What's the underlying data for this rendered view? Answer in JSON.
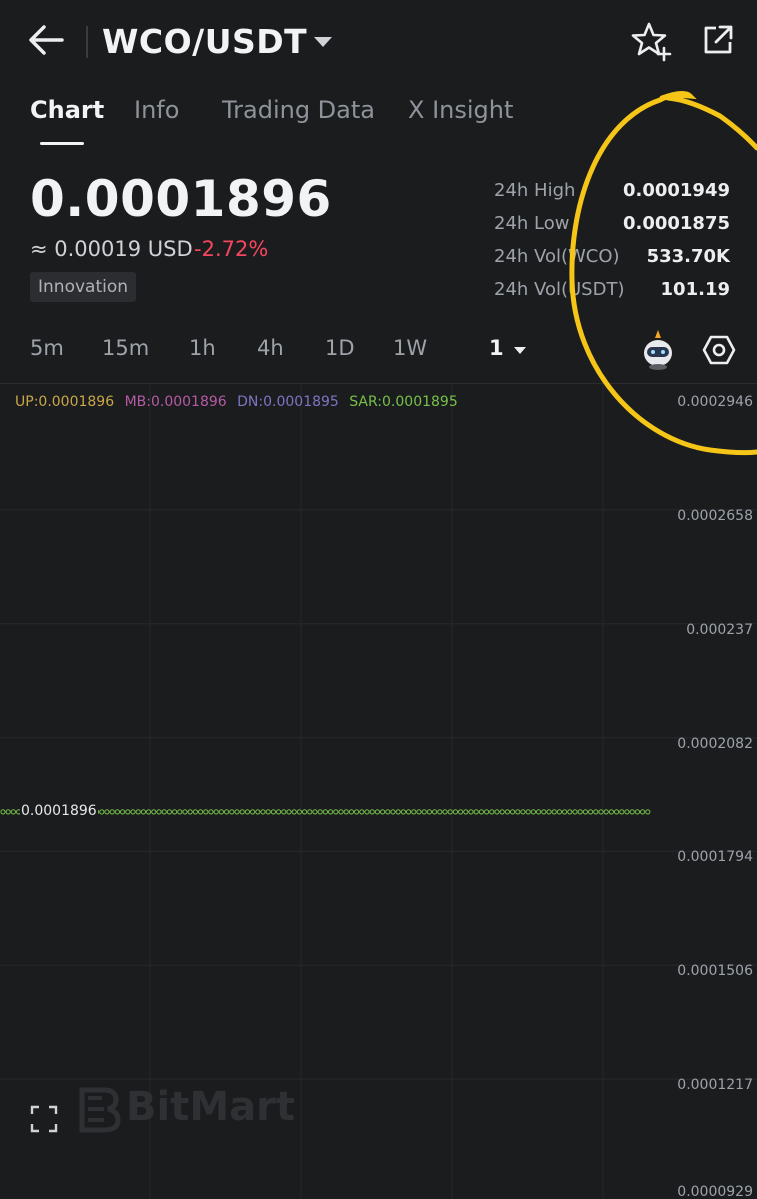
{
  "header": {
    "pair": "WCO/USDT",
    "icons": [
      "back-arrow-icon",
      "caret-down-icon",
      "star-add-icon",
      "share-external-icon"
    ]
  },
  "tabs": [
    {
      "label": "Chart",
      "active": true
    },
    {
      "label": "Info",
      "active": false
    },
    {
      "label": "Trading Data",
      "active": false
    },
    {
      "label": "X Insight",
      "active": false
    }
  ],
  "price": {
    "last": "0.0001896",
    "usd": "≈ 0.00019 USD",
    "change": "-2.72%",
    "tag": "Innovation"
  },
  "stats": [
    {
      "label": "24h High",
      "value": "0.0001949"
    },
    {
      "label": "24h Low",
      "value": "0.0001875"
    },
    {
      "label": "24h Vol(WCO)",
      "value": "533.70K"
    },
    {
      "label": "24h Vol(USDT)",
      "value": "101.19"
    }
  ],
  "intervals": [
    {
      "label": "5m"
    },
    {
      "label": "15m"
    },
    {
      "label": "1h"
    },
    {
      "label": "4h"
    },
    {
      "label": "1D"
    },
    {
      "label": "1W"
    },
    {
      "label": "1",
      "selected": true
    }
  ],
  "toolbar_icons": [
    "bot-mascot-icon",
    "hexagon-settings-icon"
  ],
  "indicators": {
    "up": "UP:0.0001896",
    "mb": "MB:0.0001896",
    "dn": "DN:0.0001895",
    "sar": "SAR:0.0001895"
  },
  "chart_data": {
    "type": "line",
    "y_ticks": [
      "0.0002946",
      "0.0002658",
      "0.000237",
      "0.0002082",
      "0.0001794",
      "0.0001506",
      "0.0001217",
      "0.0000929"
    ],
    "ylim": [
      9.29e-05,
      0.0002946
    ],
    "series": [
      {
        "name": "SAR",
        "value": 0.0001896,
        "color": "#77c04a"
      }
    ],
    "last_price_label": "0.0001896",
    "grid": true
  },
  "watermark": "BitMart",
  "colors": {
    "background": "#1b1c1e",
    "negative": "#f6465d",
    "sar": "#77c04a",
    "annotation": "#f5c518"
  }
}
